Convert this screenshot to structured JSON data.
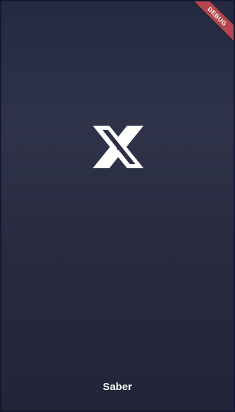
{
  "app": {
    "name": "Saber",
    "logo_icon": "saber-x-logo-icon"
  },
  "debug_banner": {
    "label": "DEBUG",
    "color": "#b4464d"
  },
  "colors": {
    "background_top": "#262a40",
    "background_mid": "#2f3349",
    "background_bottom": "#222538",
    "text": "#ffffff"
  }
}
